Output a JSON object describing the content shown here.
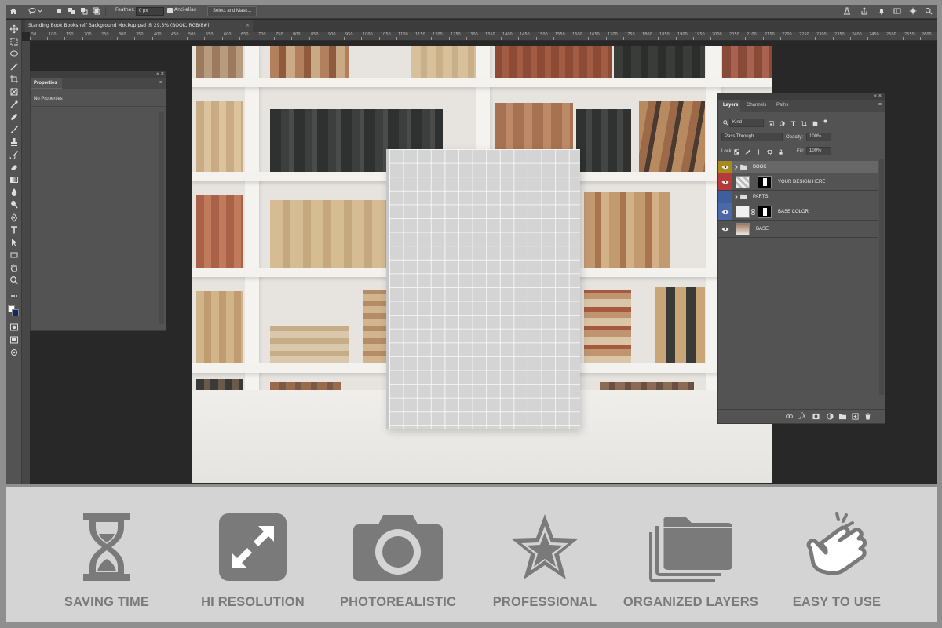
{
  "options_bar": {
    "feather_label": "Feather:",
    "feather_value": "0 px",
    "antialias_label": "Anti-alias",
    "select_mask_label": "Select and Mask..."
  },
  "document_tab": {
    "title": "Standing Book Bookshelf Background Mockup.psd @ 29,5% (BOOK, RGB/8#)",
    "close": "×"
  },
  "ruler": {
    "ticks": [
      "50",
      "100",
      "150",
      "200",
      "250",
      "300",
      "350",
      "400",
      "450",
      "500",
      "550",
      "600",
      "650",
      "700",
      "750",
      "800",
      "850",
      "900",
      "950",
      "1000",
      "1050",
      "1100",
      "1150",
      "1200",
      "1250",
      "1300",
      "1350",
      "1400",
      "1450",
      "1500",
      "1550",
      "1600",
      "1650",
      "1700",
      "1750",
      "1800",
      "1850",
      "1900",
      "1950",
      "2000",
      "2050",
      "2100",
      "2150",
      "2200",
      "2250",
      "2300",
      "2350",
      "2400",
      "2450",
      "2500",
      "2550",
      "2600"
    ]
  },
  "properties_panel": {
    "tab_label": "Properties",
    "empty_text": "No Properties",
    "menu_glyph": "≡",
    "close_glyph": "«  ×"
  },
  "layers_panel": {
    "tabs": [
      "Layers",
      "Channels",
      "Paths"
    ],
    "filter_kind": "Kind",
    "blend_mode": "Pass Through",
    "opacity_label": "Opacity:",
    "opacity_value": "100%",
    "lock_label": "Lock:",
    "fill_label": "Fill:",
    "fill_value": "100%",
    "menu_glyph": "≡",
    "close_glyph": "«  ×",
    "layers": [
      {
        "name": "BOOK",
        "type": "group",
        "color": "#a58a1e",
        "selected": true
      },
      {
        "name": "YOUR DESIGN HERE",
        "type": "smart",
        "color": "#b53a3a",
        "selected": false
      },
      {
        "name": "PARTS",
        "type": "group",
        "color": "#3f5f9c",
        "selected": false,
        "hidden": true
      },
      {
        "name": "BASE COLOR",
        "type": "fill",
        "color": "#4b68a8",
        "selected": false
      },
      {
        "name": "BASE",
        "type": "image",
        "color": "",
        "selected": false
      }
    ]
  },
  "features": [
    {
      "label": "SAVING TIME",
      "icon": "hourglass-icon"
    },
    {
      "label": "HI RESOLUTION",
      "icon": "expand-arrows-icon"
    },
    {
      "label": "PHOTOREALISTIC",
      "icon": "camera-icon"
    },
    {
      "label": "PROFESSIONAL",
      "icon": "star-icon"
    },
    {
      "label": "ORGANIZED LAYERS",
      "icon": "stacked-folders-icon"
    },
    {
      "label": "EASY TO USE",
      "icon": "tap-hand-icon"
    }
  ],
  "colors": {
    "feature_icon": "#7a7a7a",
    "feature_bg": "#d4d4d4",
    "ps_bg": "#282828",
    "panel_bg": "#535353"
  }
}
